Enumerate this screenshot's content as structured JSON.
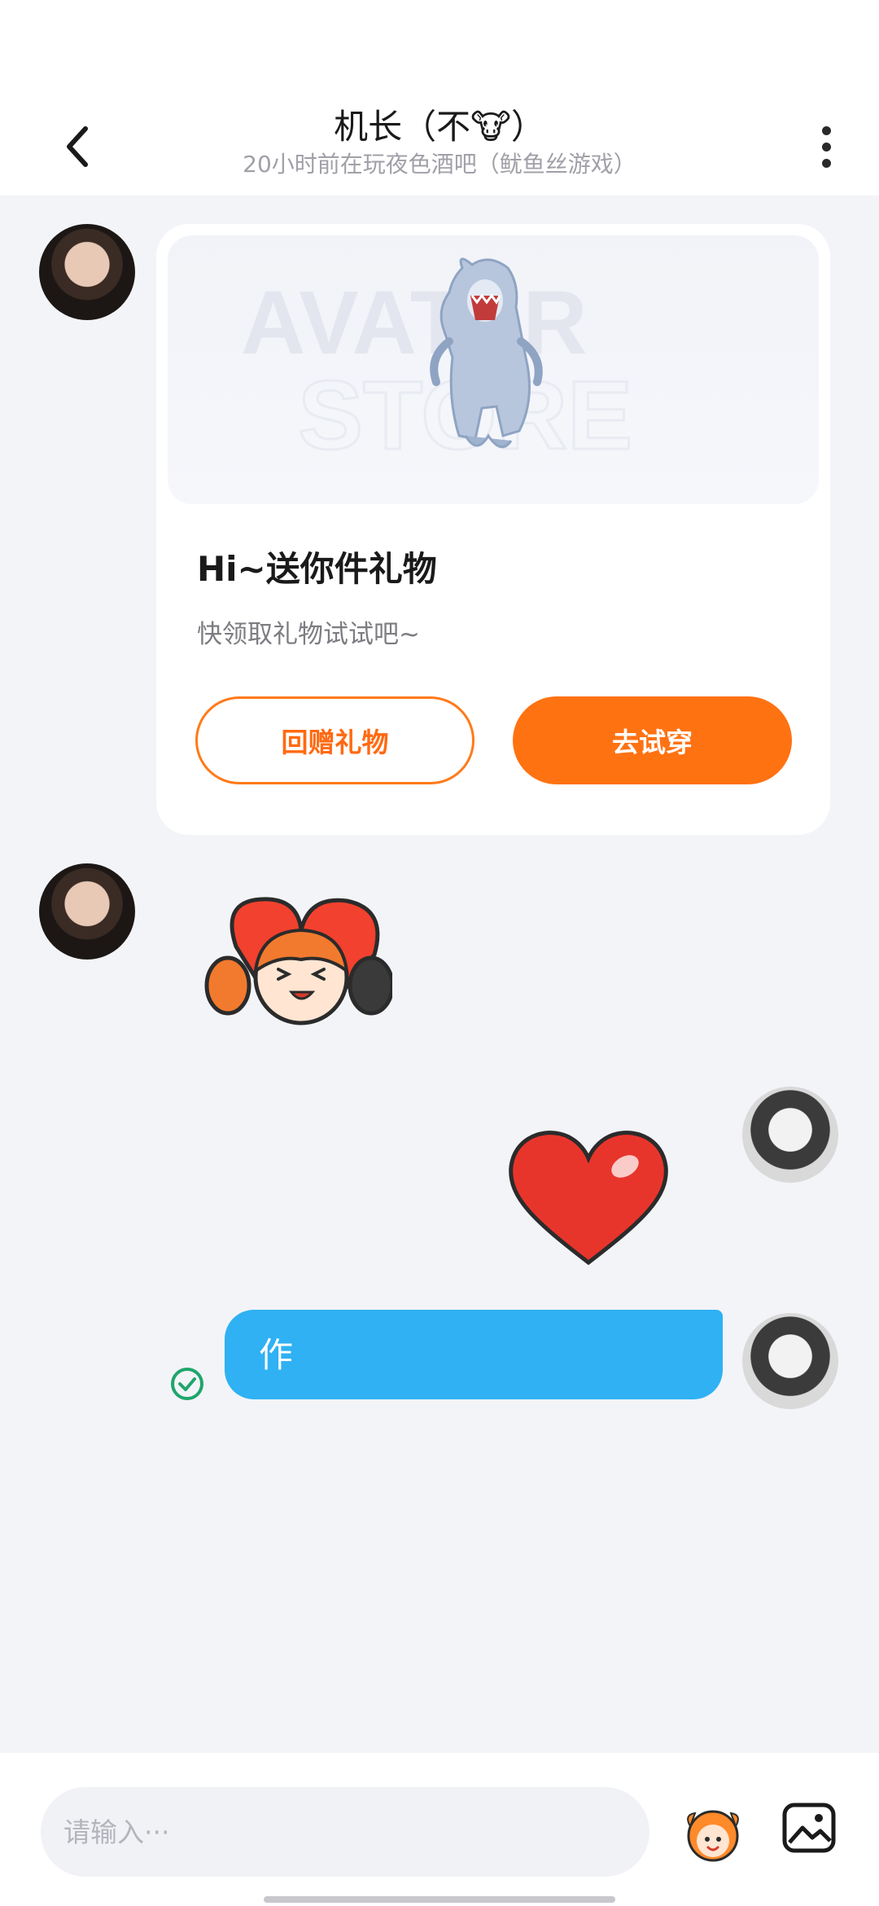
{
  "header": {
    "title": "机长（不🐮）",
    "subtitle": "20小时前在玩夜色酒吧（鱿鱼丝游戏）"
  },
  "gift_card": {
    "banner_text_line1": "AVATAR",
    "banner_text_line2": "STORE",
    "title": "Hi~送你件礼物",
    "description": "快领取礼物试试吧~",
    "return_gift_label": "回赠礼物",
    "try_on_label": "去试穿"
  },
  "messages": [
    {
      "side": "left",
      "type": "gift_card"
    },
    {
      "side": "left",
      "type": "sticker",
      "sticker": "girl-hugging-heart"
    },
    {
      "side": "right",
      "type": "sticker",
      "sticker": "red-heart"
    },
    {
      "side": "right",
      "type": "text",
      "text": "作",
      "status": "sent-check-icon"
    }
  ],
  "input_bar": {
    "placeholder": "请输入···"
  },
  "colors": {
    "accent_orange": "#ff7212",
    "bubble_blue": "#2fb1f3",
    "sent_green": "#1fa66b",
    "background": "#f3f4f8"
  }
}
